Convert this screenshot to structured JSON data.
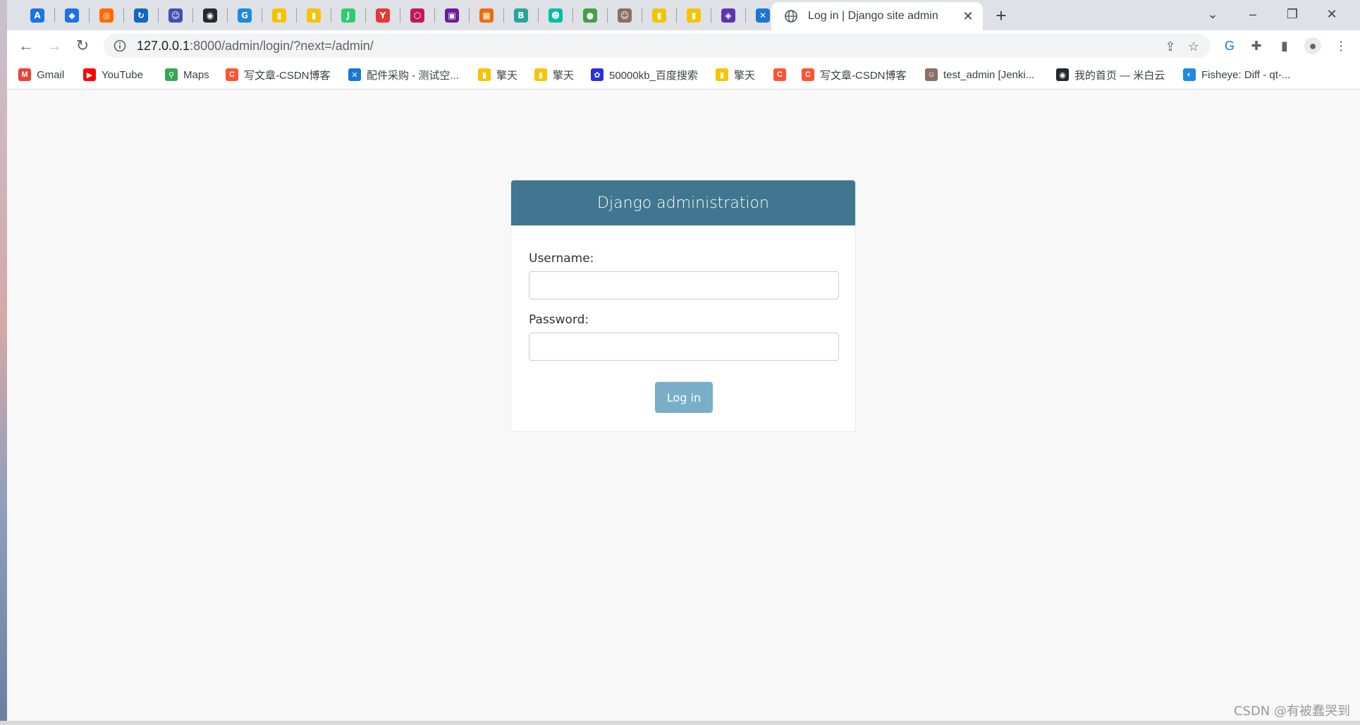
{
  "window": {
    "active_tab_title": "Log in | Django site admin",
    "pinned_tabs": [
      {
        "icon": "translate-a-icon",
        "color": "#1a73e8",
        "glyph": "A"
      },
      {
        "icon": "diamond-arrow-icon",
        "color": "#1a73e8",
        "glyph": "◆"
      },
      {
        "icon": "ring-logo-icon",
        "color": "#ff6a00",
        "glyph": "◎"
      },
      {
        "icon": "blue-swirl-icon",
        "color": "#1565c0",
        "glyph": "↻"
      },
      {
        "icon": "robot-icon",
        "color": "#3f51b5",
        "glyph": "☺"
      },
      {
        "icon": "github-cat-icon",
        "color": "#24292e",
        "glyph": "◉"
      },
      {
        "icon": "swirl-g-icon",
        "color": "#1e88e5",
        "glyph": "G"
      },
      {
        "icon": "stripe-logo-icon",
        "color": "#f5c400",
        "glyph": "▮"
      },
      {
        "icon": "stripe-logo-icon",
        "color": "#f5c400",
        "glyph": "▮"
      },
      {
        "icon": "json-icon",
        "color": "#2ecc71",
        "glyph": "J"
      },
      {
        "icon": "y-logo-icon",
        "color": "#e53935",
        "glyph": "Y"
      },
      {
        "icon": "hexagon-icon",
        "color": "#c2185b",
        "glyph": "⬡"
      },
      {
        "icon": "purple-app-icon",
        "color": "#6a1b9a",
        "glyph": "▣"
      },
      {
        "icon": "grid-app-icon",
        "color": "#ef6c00",
        "glyph": "▦"
      },
      {
        "icon": "b-logo-icon",
        "color": "#26a69a",
        "glyph": "B"
      },
      {
        "icon": "green-face-icon",
        "color": "#00bfa5",
        "glyph": "☻"
      },
      {
        "icon": "green-code-icon",
        "color": "#43a047",
        "glyph": "●"
      },
      {
        "icon": "jenkins-icon",
        "color": "#8d6e63",
        "glyph": "☺"
      },
      {
        "icon": "stripe-logo-icon",
        "color": "#f5c400",
        "glyph": "▮"
      },
      {
        "icon": "stripe-logo-icon",
        "color": "#f5c400",
        "glyph": "▮"
      },
      {
        "icon": "purple-box-icon",
        "color": "#5e35b1",
        "glyph": "◈"
      },
      {
        "icon": "confluence-icon",
        "color": "#1976d2",
        "glyph": "✕"
      }
    ]
  },
  "toolbar": {
    "url_host": "127.0.0.1",
    "url_rest": ":8000/admin/login/?next=/admin/"
  },
  "bookmarks": [
    {
      "label": "Gmail",
      "icon": "gmail-icon",
      "color": "#ea4335",
      "glyph": "M"
    },
    {
      "label": "YouTube",
      "icon": "youtube-icon",
      "color": "#ff0000",
      "glyph": "▶"
    },
    {
      "label": "Maps",
      "icon": "maps-pin-icon",
      "color": "#34a853",
      "glyph": "⚲"
    },
    {
      "label": "写文章-CSDN博客",
      "icon": "csdn-icon",
      "color": "#fc5531",
      "glyph": "C"
    },
    {
      "label": "配件采购 - 测试空...",
      "icon": "confluence-icon",
      "color": "#1976d2",
      "glyph": "✕"
    },
    {
      "label": "擎天",
      "icon": "stripe-logo-icon",
      "color": "#f5c400",
      "glyph": "▮"
    },
    {
      "label": "擎天",
      "icon": "stripe-logo-icon",
      "color": "#f5c400",
      "glyph": "▮"
    },
    {
      "label": "50000kb_百度搜索",
      "icon": "baidu-paw-icon",
      "color": "#2932e1",
      "glyph": "✿"
    },
    {
      "label": "擎天",
      "icon": "stripe-logo-icon",
      "color": "#f5c400",
      "glyph": "▮"
    },
    {
      "label": "",
      "icon": "csdn-icon",
      "color": "#fc5531",
      "glyph": "C"
    },
    {
      "label": "写文章-CSDN博客",
      "icon": "csdn-icon",
      "color": "#fc5531",
      "glyph": "C"
    },
    {
      "label": "test_admin [Jenki...",
      "icon": "jenkins-icon",
      "color": "#8d6e63",
      "glyph": "☺"
    },
    {
      "label": "我的首页 — 米白云",
      "icon": "github-cat-icon",
      "color": "#24292e",
      "glyph": "◉"
    },
    {
      "label": "Fisheye: Diff - qt-...",
      "icon": "fisheye-icon",
      "color": "#1e88e5",
      "glyph": "◐"
    }
  ],
  "login": {
    "header": "Django administration",
    "username_label": "Username:",
    "username_value": "",
    "password_label": "Password:",
    "password_value": "",
    "submit_label": "Log in"
  },
  "colors": {
    "header_bg": "#417690",
    "button_bg": "#79aec8",
    "page_bg": "#f8f8f8"
  },
  "watermark": "CSDN @有被蠢哭到"
}
